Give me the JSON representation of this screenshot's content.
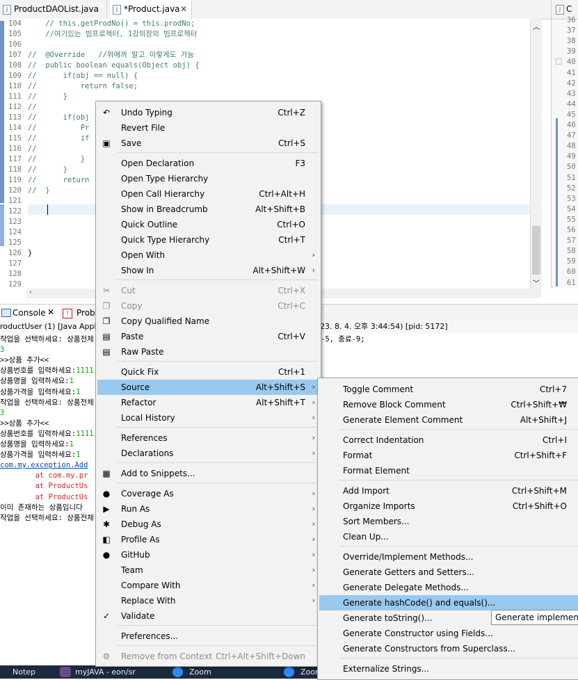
{
  "tabs": [
    {
      "label": "ProductDAOList.java",
      "active": false
    },
    {
      "label": "*Product.java",
      "active": true
    }
  ],
  "right_tab_label": "C",
  "editor": {
    "lines": [
      {
        "n": "104",
        "t": "    // this.getProdNo() = this.prodNo;"
      },
      {
        "n": "105",
        "t": "    //여기있는 빔프로젝터, 1강의장의 빔프로젝터"
      },
      {
        "n": "106",
        "t": ""
      },
      {
        "n": "107",
        "t": "//  @Override   //위에꺼 말고 이렇게도 가능"
      },
      {
        "n": "108",
        "t": "//  public boolean equals(Object obj) {"
      },
      {
        "n": "109",
        "t": "//      if(obj == null) {"
      },
      {
        "n": "110",
        "t": "//          return false;"
      },
      {
        "n": "111",
        "t": "//      }"
      },
      {
        "n": "112",
        "t": "//"
      },
      {
        "n": "113",
        "t": "//      if(obj"
      },
      {
        "n": "114",
        "t": "//          Pr"
      },
      {
        "n": "115",
        "t": "//          if"
      },
      {
        "n": "116",
        "t": "//"
      },
      {
        "n": "117",
        "t": "//          }"
      },
      {
        "n": "118",
        "t": "//      }"
      },
      {
        "n": "119",
        "t": "//      return"
      },
      {
        "n": "120",
        "t": "//  }"
      },
      {
        "n": "121",
        "t": ""
      },
      {
        "n": "122",
        "t": ""
      },
      {
        "n": "123",
        "t": ""
      },
      {
        "n": "124",
        "t": ""
      },
      {
        "n": "125",
        "t": ""
      },
      {
        "n": "126",
        "t": "}"
      },
      {
        "n": "127",
        "t": ""
      },
      {
        "n": "128",
        "t": ""
      },
      {
        "n": "129",
        "t": ""
      }
    ],
    "right_numbers": [
      "36",
      "37",
      "38",
      "39",
      "40",
      "41",
      "42",
      "43",
      "44",
      "45",
      "46",
      "47",
      "48",
      "49",
      "50",
      "51",
      "52",
      "53",
      "54",
      "55",
      "56",
      "57",
      "58",
      "59",
      "60",
      "61"
    ]
  },
  "console": {
    "tab_console": "Console",
    "tab_problems": "Probl",
    "status_left": "roductUser (1) [Java Appl",
    "status_right": "23. 8. 4. 오후 3:44:54) [pid: 5172]",
    "lines": [
      {
        "t": "작업을 선택하세요: 상품전체",
        "tail": "-5, 종료-9;",
        "c": ""
      },
      {
        "t": "3",
        "c": "green"
      },
      {
        "t": ">>상품 추가<<",
        "c": ""
      },
      {
        "t": "상품번호를 입력하세요:",
        "v": "1111",
        "c": ""
      },
      {
        "t": "상품명을 입력하세요:",
        "v": "1",
        "c": ""
      },
      {
        "t": "상품가격을 입력하세요:",
        "v": "1",
        "c": ""
      },
      {
        "t": "작업을 선택하세요: 상품전체",
        "c": ""
      },
      {
        "t": "3",
        "c": "green"
      },
      {
        "t": ">>상품 추가<<",
        "c": ""
      },
      {
        "t": "상품번호를 입력하세요:",
        "v": "1111",
        "c": ""
      },
      {
        "t": "상품명을 입력하세요:",
        "v": "1",
        "c": ""
      },
      {
        "t": "상품가격을 입력하세요:",
        "v": "1",
        "c": ""
      },
      {
        "t": "com.my.exception.Add",
        "c": "link"
      },
      {
        "t": "        at com.my.pr",
        "c": "red"
      },
      {
        "t": "        at ProductUs",
        "c": "red"
      },
      {
        "t": "        at ProductUs",
        "c": "red"
      },
      {
        "t": "이미 존재하는 상품입니다",
        "c": ""
      },
      {
        "t": "작업을 선택하세요: 상품전체",
        "c": ""
      }
    ]
  },
  "context_menu": {
    "items": [
      {
        "label": "Undo Typing",
        "acc": "Ctrl+Z",
        "icon": "undo-icon",
        "glyph": "↶"
      },
      {
        "label": "Revert File",
        "acc": ""
      },
      {
        "label": "Save",
        "acc": "Ctrl+S",
        "icon": "save-icon",
        "glyph": "▣"
      },
      {
        "sep": true
      },
      {
        "label": "Open Declaration",
        "acc": "F3"
      },
      {
        "label": "Open Type Hierarchy",
        "acc": ""
      },
      {
        "label": "Open Call Hierarchy",
        "acc": "Ctrl+Alt+H"
      },
      {
        "label": "Show in Breadcrumb",
        "acc": "Alt+Shift+B"
      },
      {
        "label": "Quick Outline",
        "acc": "Ctrl+O"
      },
      {
        "label": "Quick Type Hierarchy",
        "acc": "Ctrl+T"
      },
      {
        "label": "Open With",
        "acc": "",
        "sub": true
      },
      {
        "label": "Show In",
        "acc": "Alt+Shift+W",
        "sub": true
      },
      {
        "sep": true
      },
      {
        "label": "Cut",
        "acc": "Ctrl+X",
        "disabled": true,
        "icon": "cut-icon",
        "glyph": "✂"
      },
      {
        "label": "Copy",
        "acc": "Ctrl+C",
        "disabled": true,
        "icon": "copy-icon",
        "glyph": "❐"
      },
      {
        "label": "Copy Qualified Name",
        "acc": "",
        "icon": "copy-qualified-icon",
        "glyph": "❐"
      },
      {
        "label": "Paste",
        "acc": "Ctrl+V",
        "icon": "paste-icon",
        "glyph": "▤"
      },
      {
        "label": "Raw Paste",
        "acc": "",
        "icon": "raw-paste-icon",
        "glyph": "▤"
      },
      {
        "sep": true
      },
      {
        "label": "Quick Fix",
        "acc": "Ctrl+1"
      },
      {
        "label": "Source",
        "acc": "Alt+Shift+S",
        "sub": true,
        "highlight": true
      },
      {
        "label": "Refactor",
        "acc": "Alt+Shift+T",
        "sub": true
      },
      {
        "label": "Local History",
        "acc": "",
        "sub": true
      },
      {
        "sep": true
      },
      {
        "label": "References",
        "acc": "",
        "sub": true
      },
      {
        "label": "Declarations",
        "acc": "",
        "sub": true
      },
      {
        "sep": true
      },
      {
        "label": "Add to Snippets...",
        "acc": "",
        "icon": "snippets-icon",
        "glyph": "▦"
      },
      {
        "sep": true
      },
      {
        "label": "Coverage As",
        "acc": "",
        "sub": true,
        "icon": "coverage-icon",
        "glyph": "●"
      },
      {
        "label": "Run As",
        "acc": "",
        "sub": true,
        "icon": "run-icon",
        "glyph": "▶"
      },
      {
        "label": "Debug As",
        "acc": "",
        "sub": true,
        "icon": "debug-icon",
        "glyph": "✱"
      },
      {
        "label": "Profile As",
        "acc": "",
        "sub": true,
        "icon": "profile-icon",
        "glyph": "◧"
      },
      {
        "label": "GitHub",
        "acc": "",
        "sub": true,
        "icon": "github-icon",
        "glyph": "●"
      },
      {
        "label": "Team",
        "acc": "",
        "sub": true
      },
      {
        "label": "Compare With",
        "acc": "",
        "sub": true
      },
      {
        "label": "Replace With",
        "acc": "",
        "sub": true
      },
      {
        "label": "Validate",
        "acc": "",
        "icon": "validate-check-icon",
        "glyph": "✓"
      },
      {
        "sep": true
      },
      {
        "label": "Preferences...",
        "acc": ""
      },
      {
        "sep": true
      },
      {
        "label": "Remove from Context",
        "acc": "Ctrl+Alt+Shift+Down",
        "disabled": true,
        "icon": "remove-context-icon",
        "glyph": "⚙"
      }
    ]
  },
  "source_menu": {
    "items": [
      {
        "label": "Toggle Comment",
        "acc": "Ctrl+7"
      },
      {
        "label": "Remove Block Comment",
        "acc": "Ctrl+Shift+₩"
      },
      {
        "label": "Generate Element Comment",
        "acc": "Alt+Shift+J"
      },
      {
        "sep": true
      },
      {
        "label": "Correct Indentation",
        "acc": "Ctrl+I"
      },
      {
        "label": "Format",
        "acc": "Ctrl+Shift+F"
      },
      {
        "label": "Format Element",
        "acc": ""
      },
      {
        "sep": true
      },
      {
        "label": "Add Import",
        "acc": "Ctrl+Shift+M"
      },
      {
        "label": "Organize Imports",
        "acc": "Ctrl+Shift+O"
      },
      {
        "label": "Sort Members...",
        "acc": ""
      },
      {
        "label": "Clean Up...",
        "acc": ""
      },
      {
        "sep": true
      },
      {
        "label": "Override/Implement Methods...",
        "acc": ""
      },
      {
        "label": "Generate Getters and Setters...",
        "acc": ""
      },
      {
        "label": "Generate Delegate Methods...",
        "acc": ""
      },
      {
        "label": "Generate hashCode() and equals()...",
        "acc": "",
        "highlight": true
      },
      {
        "label": "Generate toString()...",
        "acc": ""
      },
      {
        "label": "Generate Constructor using Fields...",
        "acc": ""
      },
      {
        "label": "Generate Constructors from Superclass...",
        "acc": ""
      },
      {
        "sep": true
      },
      {
        "label": "Externalize Strings...",
        "acc": ""
      }
    ]
  },
  "tooltip": "Generate implementatio",
  "taskbar": {
    "items": [
      "Notep",
      "myJAVA - eon/sr",
      "Zoom",
      "Zoom"
    ]
  }
}
